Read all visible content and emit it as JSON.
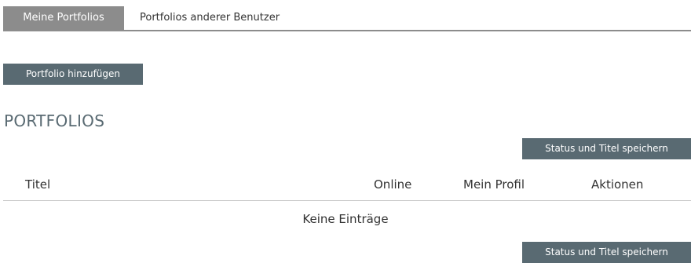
{
  "tabs": [
    {
      "label": "Meine Portfolios",
      "active": true
    },
    {
      "label": "Portfolios anderer Benutzer",
      "active": false
    }
  ],
  "buttons": {
    "add_portfolio": "Portfolio hinzufügen",
    "save_status_top": "Status und Titel speichern",
    "save_status_bottom": "Status und Titel speichern"
  },
  "section": {
    "title": "PORTFOLIOS"
  },
  "table": {
    "columns": [
      "Titel",
      "Online",
      "Mein Profil",
      "Aktionen"
    ],
    "empty_message": "Keine Einträge"
  },
  "colors": {
    "tab_active_bg": "#8c8c8c",
    "button_bg": "#596a72",
    "title_color": "#596a72"
  }
}
